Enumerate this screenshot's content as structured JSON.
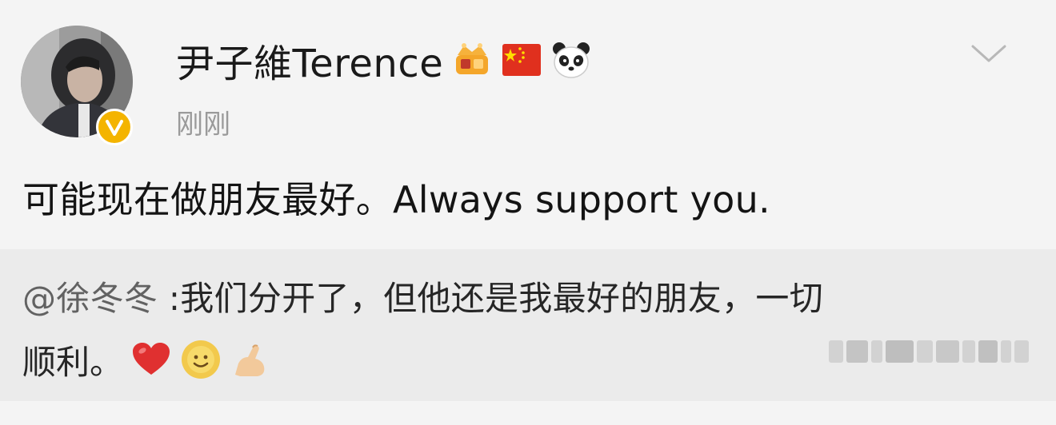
{
  "post": {
    "author": {
      "name": "尹子維Terence",
      "verified": true,
      "verify_color": "#f4b400"
    },
    "header_badges": [
      "crown-badge-icon",
      "china-flag-icon",
      "panda-icon"
    ],
    "timestamp": "刚刚",
    "menu_icon": "chevron-down-icon",
    "text": "可能现在做朋友最好。Always support you."
  },
  "repost": {
    "mention": "@徐冬冬",
    "line1_text": " :我们分开了，但他还是我最好的朋友，一切",
    "line2_text": "顺利。",
    "emojis": [
      "heart-icon",
      "smile-face-icon",
      "flexed-arm-icon"
    ],
    "heart_color": "#e03030",
    "obscured_content": true
  },
  "colors": {
    "background": "#f4f4f4",
    "repost_background": "#ebebeb",
    "secondary_text": "#9a9a9a",
    "mention_text": "#626262"
  }
}
